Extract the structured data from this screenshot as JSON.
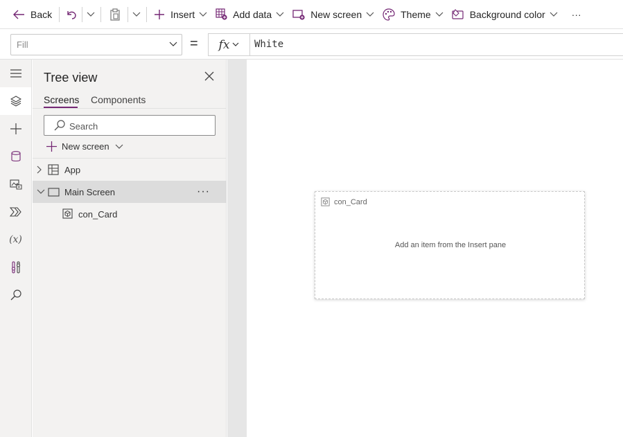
{
  "toolbar": {
    "back_label": "Back",
    "insert_label": "Insert",
    "add_data_label": "Add data",
    "new_screen_label": "New screen",
    "theme_label": "Theme",
    "background_color_label": "Background color",
    "more_label": "···"
  },
  "formula_bar": {
    "property": "Fill",
    "equals": "=",
    "fx_label": "fx",
    "formula": "White"
  },
  "rail": {
    "variables_glyph": "(x)"
  },
  "tree_view": {
    "title": "Tree view",
    "tabs": [
      {
        "label": "Screens"
      },
      {
        "label": "Components"
      }
    ],
    "search_placeholder": "Search",
    "new_screen_label": "New screen",
    "nodes": [
      {
        "label": "App"
      },
      {
        "label": "Main Screen"
      },
      {
        "label": "con_Card"
      }
    ],
    "more_glyph": "···"
  },
  "canvas": {
    "card_name": "con_Card",
    "card_hint": "Add an item from the Insert pane"
  },
  "colors": {
    "accent": "#742774",
    "selected_row": "#dcdcdc",
    "panel_bg": "#f3f2f1",
    "canvas_bg": "#e6e6e6"
  },
  "icons": [
    "back-arrow-icon",
    "undo-icon",
    "paste-icon",
    "plus-icon",
    "add-data-icon",
    "new-screen-icon",
    "theme-palette-icon",
    "background-color-icon",
    "hamburger-icon",
    "layers-icon",
    "database-icon",
    "media-icon",
    "power-automate-icon",
    "settings-tools-icon",
    "search-icon",
    "close-icon",
    "screen-icon",
    "container-icon",
    "app-icon"
  ]
}
